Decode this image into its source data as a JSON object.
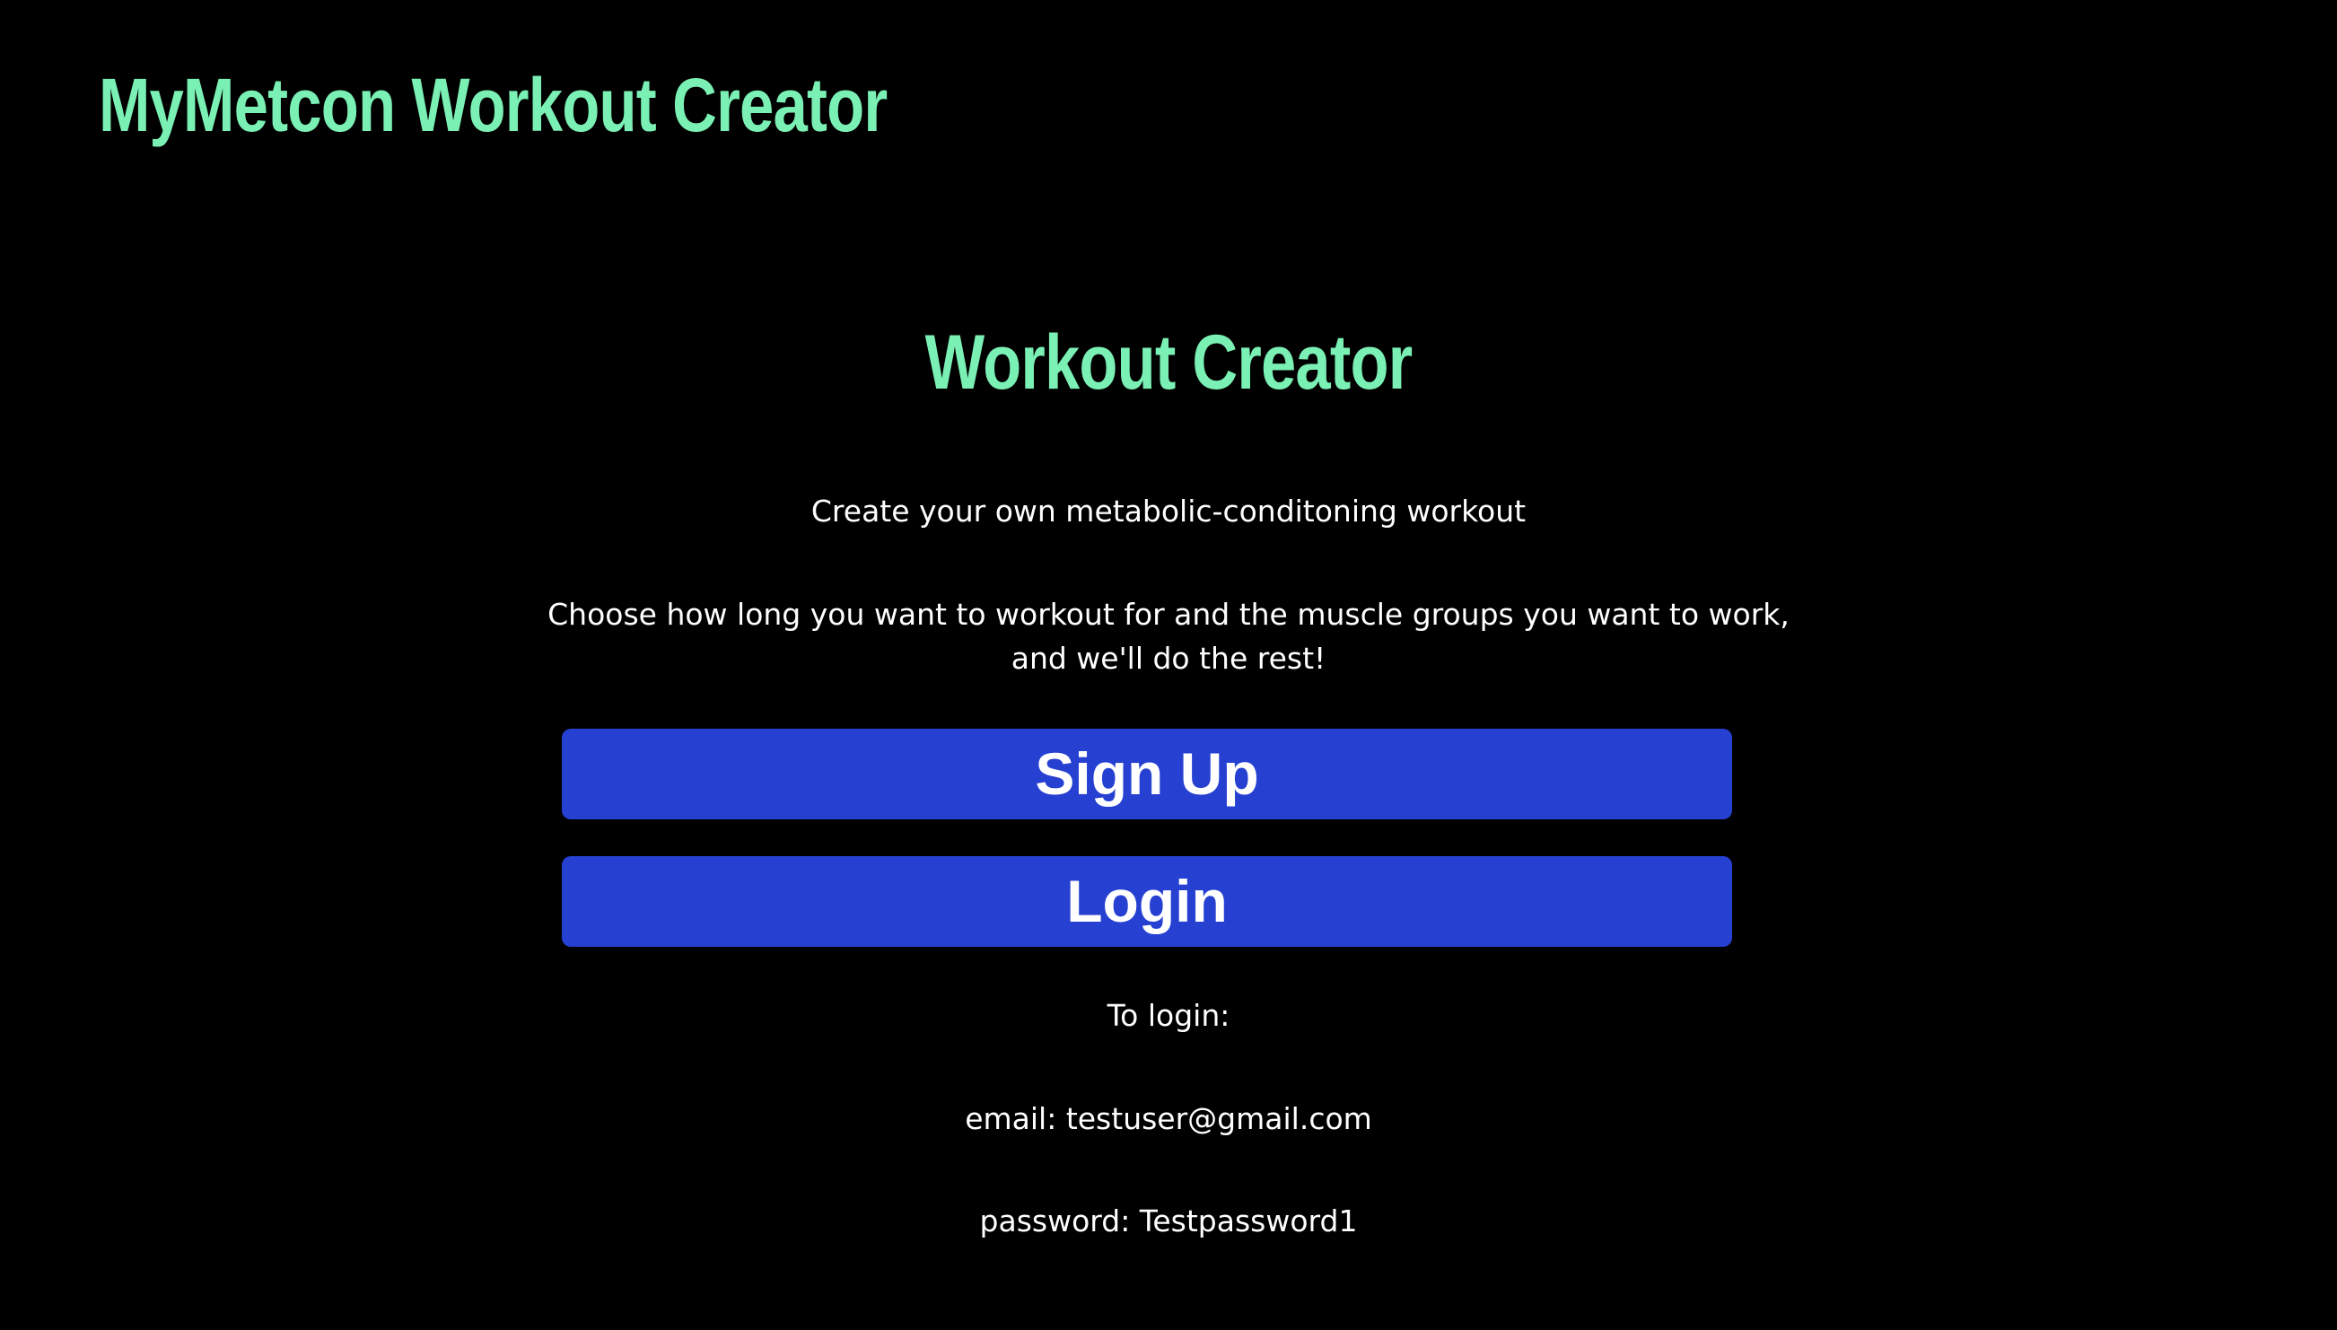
{
  "header": {
    "site_title": "MyMetcon Workout Creator"
  },
  "main": {
    "heading": "Workout Creator",
    "subtitle": "Create your own metabolic-conditoning workout",
    "description_line1": "Choose how long you want to workout for and the muscle groups you want to work,",
    "description_line2": "and we'll do the rest!",
    "signup_label": "Sign Up",
    "login_label": "Login",
    "login_info_heading": "To login:",
    "login_email": "email: testuser@gmail.com",
    "login_password": "password: Testpassword1"
  },
  "colors": {
    "background": "#000000",
    "accent_green": "#7af0b4",
    "button_blue": "#2640d2",
    "text": "#ffffff"
  }
}
